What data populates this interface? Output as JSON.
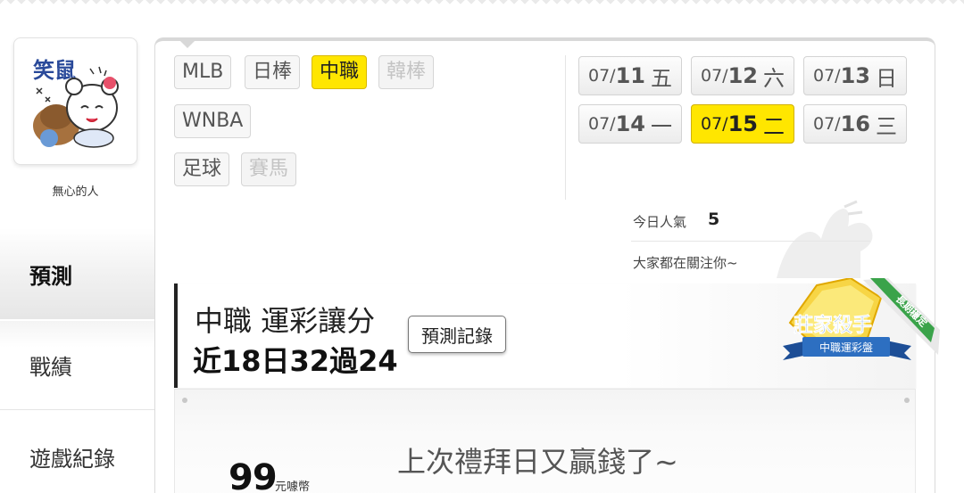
{
  "user": {
    "name": "無心的人",
    "avatar_text": "笑鼠"
  },
  "side_nav": [
    {
      "label": "預測",
      "active": true
    },
    {
      "label": "戰績",
      "active": false
    },
    {
      "label": "遊戲紀錄",
      "active": false
    }
  ],
  "leagues": [
    {
      "label": "MLB",
      "state": "normal"
    },
    {
      "label": "日棒",
      "state": "normal"
    },
    {
      "label": "中職",
      "state": "active"
    },
    {
      "label": "韓棒",
      "state": "disabled"
    },
    {
      "label": "WNBA",
      "state": "normal"
    },
    {
      "label": "足球",
      "state": "normal"
    },
    {
      "label": "賽馬",
      "state": "disabled"
    }
  ],
  "dates": [
    {
      "md": "07/",
      "day": "11",
      "weekday": "五",
      "active": false
    },
    {
      "md": "07/",
      "day": "12",
      "weekday": "六",
      "active": false
    },
    {
      "md": "07/",
      "day": "13",
      "weekday": "日",
      "active": false
    },
    {
      "md": "07/",
      "day": "14",
      "weekday": "一",
      "active": false
    },
    {
      "md": "07/",
      "day": "15",
      "weekday": "二",
      "active": true
    },
    {
      "md": "07/",
      "day": "16",
      "weekday": "三",
      "active": false
    }
  ],
  "popularity": {
    "label": "今日人氣",
    "value": "5"
  },
  "follow_text": "大家都在關注你~",
  "prediction": {
    "title": "中職 運彩讓分",
    "record": "近18日32過24",
    "history_button": "預測記錄"
  },
  "badge": {
    "title": "莊家殺手",
    "subtitle": "中職運彩盤",
    "ribbon": "長期穩定"
  },
  "post": {
    "text": "上次禮拜日又贏錢了~",
    "coins": "99",
    "coin_unit": "元噱幣"
  },
  "colors": {
    "accent": "#ffe600",
    "badge_green": "#3aa34a",
    "badge_blue": "#2d6fc1"
  }
}
